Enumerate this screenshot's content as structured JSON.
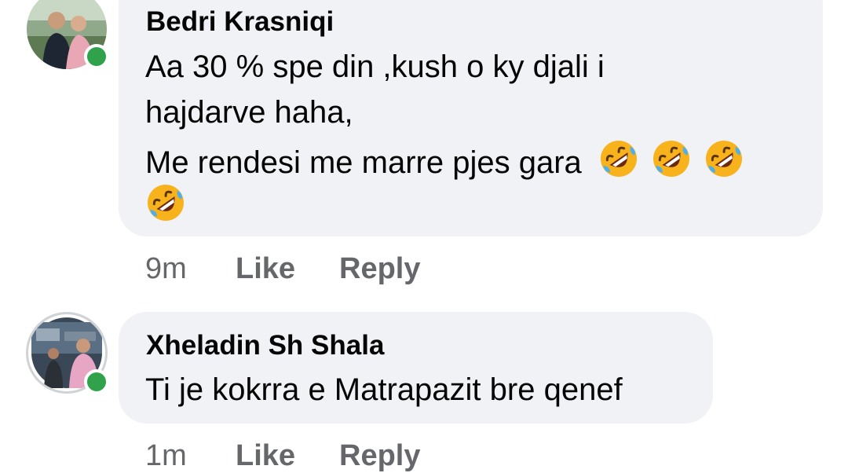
{
  "comments": [
    {
      "author": "Bedri Krasniqi",
      "lines": [
        "Aa 30 % spe din ,kush o ky djali i",
        "hajdarve haha,",
        "Me rendesi me marre pjes gara"
      ],
      "emoji_icon": "rolling-on-the-floor-laughing-emoji",
      "time": "9m",
      "like_label": "Like",
      "reply_label": "Reply",
      "online": true
    },
    {
      "author": "Xheladin Sh Shala",
      "lines": [
        "Ti je kokrra e Matrapazit bre qenef"
      ],
      "time": "1m",
      "like_label": "Like",
      "reply_label": "Reply",
      "online": true
    }
  ],
  "colors": {
    "bubble": "#f0f2f5",
    "meta_text": "#65676b",
    "online": "#31a24c"
  }
}
